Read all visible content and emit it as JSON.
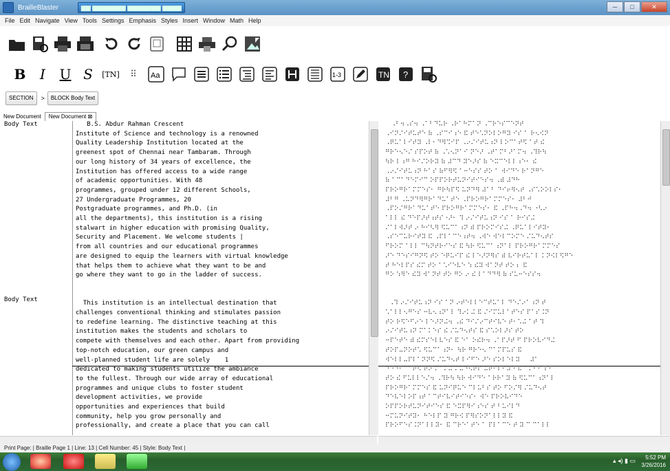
{
  "window": {
    "title": "BrailleBlaster",
    "tab_title": "▆▆ ▆▆▆▆▆▆▆ ▆▆▆▆▆▆▆ ▆▆▆▆",
    "min": "─",
    "max": "□",
    "close": "✕"
  },
  "menu": [
    "File",
    "Edit",
    "Navigate",
    "View",
    "Tools",
    "Settings",
    "Emphasis",
    "Styles",
    "Insert",
    "Window",
    "Math",
    "Help"
  ],
  "toolbar1": [
    "open-icon",
    "save-icon",
    "print-icon",
    "emboss-icon",
    "undo-icon",
    "redo-icon",
    "clipboard-icon",
    "table-icon",
    "print-preview-icon",
    "search-icon",
    "image-icon"
  ],
  "toolbar2": [
    {
      "name": "bold-button",
      "glyph": "B"
    },
    {
      "name": "italic-button",
      "glyph": "I"
    },
    {
      "name": "underline-button",
      "glyph": "U"
    },
    {
      "name": "script-button",
      "glyph": "S"
    },
    {
      "name": "tn-button",
      "glyph": "[TN]"
    },
    {
      "name": "braille-dots-button",
      "glyph": "⠿"
    }
  ],
  "toolbar2_icons": [
    "aa-icon",
    "speech-bubble-icon",
    "list-icon",
    "numbered-list-icon",
    "indent-icon",
    "align-icon",
    "heading-icon",
    "block-icon",
    "one-three-icon",
    "edit-icon",
    "transcriber-icon",
    "note-icon",
    "save-as-icon"
  ],
  "breadcrumb": {
    "section": "SECTION",
    "sep": ">",
    "block": "BLOCK Body Text"
  },
  "tabs": [
    {
      "label": "New Document"
    },
    {
      "label": "New Document ⊠"
    }
  ],
  "editor": {
    "style_labels": [
      "Body Text",
      "Body Text"
    ],
    "lines": [
      "   B.S. Abdur Rahman Crescent",
      "Institute of Science and technology is a renowned",
      "Quality Leadership Institution located at the",
      "greenest spot of Chennai near Tambaram. Through",
      "our long history of 34 years of excellence, the",
      "Institution has offered access to a wide range",
      "of academic opportunities. With 48",
      "programmes, grouped under 12 different Schools,",
      "27 Undergraduate Programmes, 20",
      "Postgraduate programmes, and Ph.D. (in",
      "all the departments), this institution is a rising",
      "stalwart in higher education with promising Quality,",
      "Security and Placement. We welcome students |",
      "from all countries and our educational programmes",
      "are designed to equip the learners with virtual knowledge",
      "that helps them to achieve what they want to be and",
      "go where they want to go in the ladder of success.",
      "",
      "",
      "  This institution is an intellectual destination that",
      "challenges conventional thinking and stimulates passion",
      "to redefine learning. The distinctive teaching at this",
      "institution makes the students and scholars to",
      "compete with themselves and each other. Apart from providing",
      "top-notch education, our green campus and",
      "well-planned student life are solely    1",
      "dedicated to making students utilize the ambiance",
      "to the fullest. Through our wide array of educational",
      "programmes and unique clubs to foster student",
      "development activities, we provide",
      "opportunities and experiences that build",
      "community, help you grow personally and",
      "professionally, and create a place that you can call"
    ]
  },
  "braille": {
    "lines": [
      "   ⠠⠃⠲⠠⠎⠲ ⠠⠁⠃⠙⠥⠗ ⠠⠗⠁⠓⠍⠁⠝ ⠠⠉⠗⠑⠎⠉⠑⠝⠞",
      "⠠⠊⠝⠌⠊⠞⠥⠞⠑ ⠷ ⠠⠎⠉⠊⠰⠑ ⠯ ⠞⠑⠡⠝⠕⠇⠕⠛⠽ ⠊⠎ ⠁ ⠗⠢⠪⠝",
      "⠠⠟⠥⠁⠇⠊⠞⠽ ⠠⠇⠂⠙⠻⠩⠊⠏ ⠠⠔⠌⠊⠞⠥⠰⠝ ⠇⠕⠉⠁⠞⠫ ⠁⠞ ⠮",
      "⠛⠗⠑⠢⠑⠌ ⠎⠏⠕⠞ ⠷ ⠠⠡⠢⠝⠁⠊ ⠝⠑⠜ ⠠⠞⠁⠍⠃⠜⠁⠍⠲ ⠠⠹⠗⠳",
      "⠳⠗ ⠇⠰⠛ ⠓⠊⠌⠕⠗⠽ ⠷ ⠼⠉⠙ ⠽⠑⠜⠎ ⠷ ⠑⠭⠉⠑⠇⠇⠰⠑⠂ ⠮",
      "⠠⠔⠌⠊⠞⠥⠰⠝ ⠓⠁⠎ ⠷⠋⠻⠫ ⠁⠒⠑⠎⠎ ⠞⠕ ⠁ ⠺⠊⠙⠑ ⠗⠁⠝⠛⠑",
      "⠷ ⠁⠉⠁⠙⠑⠍⠊⠉ ⠕⠏⠏⠕⠗⠞⠥⠝⠊⠞⠊⠑⠎⠲ ⠠⠾ ⠼⠙⠓",
      "⠏⠗⠕⠛⠗⠁⠍⠍⠑⠎⠂ ⠛⠗⠳⠏⠫ ⠥⠝⠙⠻ ⠼⠁⠃ ⠙⠊⠖⠻⠢⠞ ⠠⠎⠡⠕⠕⠇⠎⠂",
      "⠼⠃⠛ ⠠⠥⠝⠙⠻⠛⠗⠁⠙⠥⠁⠞⠑ ⠠⠏⠗⠕⠛⠗⠁⠍⠍⠑⠎⠂ ⠼⠃⠚",
      "⠠⠏⠕⠌⠛⠗⠁⠙⠥⠁⠞⠑ ⠏⠗⠕⠛⠗⠁⠍⠍⠑⠎⠂ ⠯ ⠠⠏⠓⠲⠠⠙⠲ ⠐⠣⠔",
      "⠁⠇⠇ ⠮ ⠙⠑⠏⠜⠞⠰⠞⠎⠐⠜⠂ ⠹ ⠔⠌⠊⠞⠥⠰⠝ ⠊⠎ ⠁ ⠗⠊⠎⠬",
      "⠌⠁⠇⠺⠜⠞ ⠔ ⠓⠊⠣⠻ ⠫⠥⠉⠁⠰⠝ ⠾ ⠏⠗⠕⠍⠊⠎⠬ ⠠⠟⠥⠁⠇⠊⠞⠽⠂",
      "⠠⠎⠑⠉⠥⠗⠊⠞⠽ ⠯ ⠠⠏⠇⠁⠉⠑⠰⠞⠲ ⠠⠺⠑ ⠺⠑⠇⠉⠕⠍⠑ ⠌⠥⠙⠢⠞⠎",
      "⠋⠗⠕⠍ ⠁⠇⠇ ⠉⠳⠝⠞⠗⠊⠑⠎ ⠯ ⠳⠗ ⠫⠥⠉⠁⠰⠝⠁⠇ ⠏⠗⠕⠛⠗⠁⠍⠍⠑⠎",
      "⠜⠑ ⠙⠑⠎⠊⠛⠝⠫ ⠞⠕ ⠑⠟⠥⠊⠏ ⠮ ⠇⠑⠜⠝⠻⠎ ⠾ ⠧⠊⠗⠞⠥⠁⠇ ⠅⠝⠪⠇⠫⠛⠑",
      "⠞ ⠓⠑⠇⠏⠎ ⠮⠍ ⠞⠕ ⠁⠡⠊⠑⠧⠑ ⠱ ⠮⠽ ⠺⠁⠝⠞ ⠞⠕ ⠆ ⠯",
      "⠛⠕ ⠱⠻⠑ ⠮⠽ ⠺⠁⠝⠞ ⠞⠕ ⠛⠕ ⠔ ⠮ ⠇⠁⠙⠙⠻ ⠷ ⠎⠥⠒⠑⠎⠎⠲",
      "",
      "",
      "  ⠠⠹ ⠔⠌⠊⠞⠥⠰⠝ ⠊⠎ ⠁⠝ ⠔⠞⠑⠇⠇⠑⠉⠞⠥⠁⠇ ⠙⠑⠌⠔⠁⠰⠝ ⠞",
      "⠡⠁⠇⠇⠢⠛⠑⠎ ⠒⠧⠢⠰⠝⠁⠇ ⠹⠔⠅⠬ ⠯ ⠌⠊⠍⠥⠇⠁⠞⠑⠎ ⠏⠁⠎⠨⠝",
      "⠞⠕ ⠗⠫⠑⠋⠔⠑ ⠇⠑⠜⠝⠬⠲ ⠠⠮ ⠙⠊⠌⠔⠉⠞⠊⠧⠑ ⠞⠂⠡⠬ ⠁⠞ ⠹",
      "⠔⠌⠊⠞⠥⠰⠝ ⠍⠁⠅⠑⠎ ⠮ ⠌⠥⠙⠢⠞⠎ ⠯ ⠎⠡⠕⠇⠜⠎ ⠞⠕",
      "⠒⠏⠑⠞⠑ ⠾ ⠮⠍⠎⠑⠇⠧⠑⠎ ⠯ ⠑⠁ ⠕⠮⠗⠲ ⠠⠁⠏⠜⠞ ⠋ ⠏⠗⠕⠧⠊⠙⠬",
      "⠞⠕⠏⠤⠝⠕⠞⠡ ⠫⠥⠉⠁⠰⠝⠂ ⠳⠗ ⠛⠗⠑⠢ ⠉⠁⠍⠏⠥⠎ ⠯",
      "⠺⠑⠇⠇⠤⠏⠇⠁⠝⠝⠫ ⠌⠥⠙⠢⠞ ⠇⠊⠋⠑ ⠜⠑ ⠎⠕⠇⠑⠇⠽     ⠼⠁",
      "⠙⠑⠙⠊⠉⠁⠞⠫ ⠞⠕ ⠍⠁⠅⠬ ⠌⠥⠙⠢⠞⠎ ⠥⠞⠊⠇⠊⠵⠑ ⠮ ⠁⠍⠃⠊⠰⠑",
      "⠞⠕ ⠮ ⠋⠥⠇⠇⠑⠌⠲ ⠠⠹⠗⠳ ⠳⠗ ⠺⠊⠙⠑ ⠁⠗⠗⠁⠽ ⠷ ⠫⠥⠉⠁⠰⠝⠁⠇",
      "⠏⠗⠕⠛⠗⠁⠍⠍⠑⠎ ⠯ ⠥⠝⠊⠟⠥⠑ ⠉⠇⠥⠃⠎ ⠞⠕ ⠋⠕⠌⠻ ⠌⠥⠙⠢⠞",
      "⠙⠑⠧⠑⠇⠕⠏⠰⠞ ⠁⠉⠞⠊⠧⠊⠞⠊⠑⠎⠂ ⠺⠑ ⠏⠗⠕⠧⠊⠙⠑",
      "⠕⠏⠏⠕⠗⠞⠥⠝⠊⠞⠊⠑⠎ ⠯ ⠑⠭⠏⠻⠊⠰⠑⠎ ⠞ ⠃⠥⠊⠇⠙",
      "⠒⠍⠥⠝⠊⠞⠽⠂ ⠓⠑⠇⠏ ⠽ ⠛⠗⠪ ⠏⠻⠎⠕⠝⠁⠇⠇⠽ ⠯",
      "⠏⠗⠕⠋⠑⠎⠨⠝⠁⠇⠇⠽⠂ ⠯ ⠉⠗⠑⠁⠞⠑ ⠁ ⠏⠇⠁⠉⠑ ⠞ ⠽ ⠉ ⠉⠁⠇⠇"
    ]
  },
  "status_text": "Print Page: | Braille Page 1 | Line: 13 | Cell Number: 45 | Style: Body Text |",
  "clock": {
    "time": "5:52 PM",
    "date": "3/26/2016"
  }
}
